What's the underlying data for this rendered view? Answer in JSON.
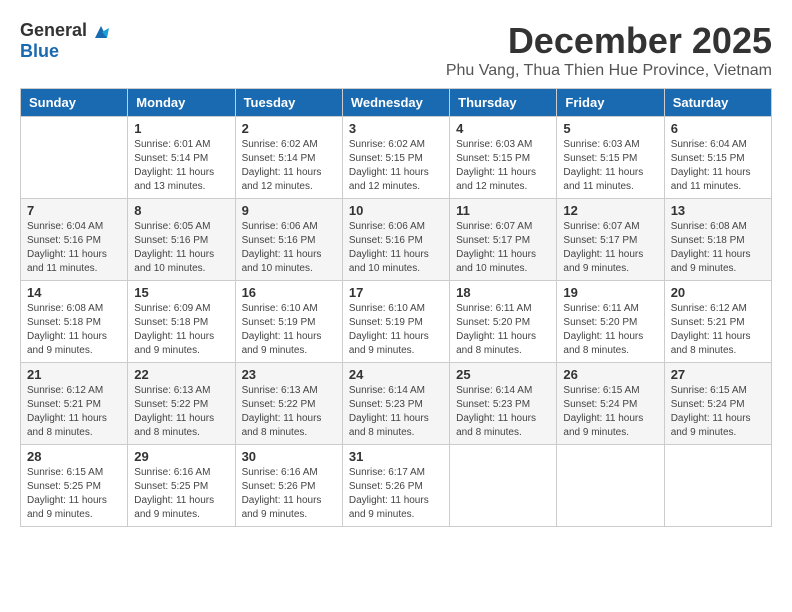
{
  "header": {
    "logo_general": "General",
    "logo_blue": "Blue",
    "month_title": "December 2025",
    "subtitle": "Phu Vang, Thua Thien Hue Province, Vietnam"
  },
  "weekdays": [
    "Sunday",
    "Monday",
    "Tuesday",
    "Wednesday",
    "Thursday",
    "Friday",
    "Saturday"
  ],
  "weeks": [
    [
      {
        "day": "",
        "sunrise": "",
        "sunset": "",
        "daylight": ""
      },
      {
        "day": "1",
        "sunrise": "Sunrise: 6:01 AM",
        "sunset": "Sunset: 5:14 PM",
        "daylight": "Daylight: 11 hours and 13 minutes."
      },
      {
        "day": "2",
        "sunrise": "Sunrise: 6:02 AM",
        "sunset": "Sunset: 5:14 PM",
        "daylight": "Daylight: 11 hours and 12 minutes."
      },
      {
        "day": "3",
        "sunrise": "Sunrise: 6:02 AM",
        "sunset": "Sunset: 5:15 PM",
        "daylight": "Daylight: 11 hours and 12 minutes."
      },
      {
        "day": "4",
        "sunrise": "Sunrise: 6:03 AM",
        "sunset": "Sunset: 5:15 PM",
        "daylight": "Daylight: 11 hours and 12 minutes."
      },
      {
        "day": "5",
        "sunrise": "Sunrise: 6:03 AM",
        "sunset": "Sunset: 5:15 PM",
        "daylight": "Daylight: 11 hours and 11 minutes."
      },
      {
        "day": "6",
        "sunrise": "Sunrise: 6:04 AM",
        "sunset": "Sunset: 5:15 PM",
        "daylight": "Daylight: 11 hours and 11 minutes."
      }
    ],
    [
      {
        "day": "7",
        "sunrise": "Sunrise: 6:04 AM",
        "sunset": "Sunset: 5:16 PM",
        "daylight": "Daylight: 11 hours and 11 minutes."
      },
      {
        "day": "8",
        "sunrise": "Sunrise: 6:05 AM",
        "sunset": "Sunset: 5:16 PM",
        "daylight": "Daylight: 11 hours and 10 minutes."
      },
      {
        "day": "9",
        "sunrise": "Sunrise: 6:06 AM",
        "sunset": "Sunset: 5:16 PM",
        "daylight": "Daylight: 11 hours and 10 minutes."
      },
      {
        "day": "10",
        "sunrise": "Sunrise: 6:06 AM",
        "sunset": "Sunset: 5:16 PM",
        "daylight": "Daylight: 11 hours and 10 minutes."
      },
      {
        "day": "11",
        "sunrise": "Sunrise: 6:07 AM",
        "sunset": "Sunset: 5:17 PM",
        "daylight": "Daylight: 11 hours and 10 minutes."
      },
      {
        "day": "12",
        "sunrise": "Sunrise: 6:07 AM",
        "sunset": "Sunset: 5:17 PM",
        "daylight": "Daylight: 11 hours and 9 minutes."
      },
      {
        "day": "13",
        "sunrise": "Sunrise: 6:08 AM",
        "sunset": "Sunset: 5:18 PM",
        "daylight": "Daylight: 11 hours and 9 minutes."
      }
    ],
    [
      {
        "day": "14",
        "sunrise": "Sunrise: 6:08 AM",
        "sunset": "Sunset: 5:18 PM",
        "daylight": "Daylight: 11 hours and 9 minutes."
      },
      {
        "day": "15",
        "sunrise": "Sunrise: 6:09 AM",
        "sunset": "Sunset: 5:18 PM",
        "daylight": "Daylight: 11 hours and 9 minutes."
      },
      {
        "day": "16",
        "sunrise": "Sunrise: 6:10 AM",
        "sunset": "Sunset: 5:19 PM",
        "daylight": "Daylight: 11 hours and 9 minutes."
      },
      {
        "day": "17",
        "sunrise": "Sunrise: 6:10 AM",
        "sunset": "Sunset: 5:19 PM",
        "daylight": "Daylight: 11 hours and 9 minutes."
      },
      {
        "day": "18",
        "sunrise": "Sunrise: 6:11 AM",
        "sunset": "Sunset: 5:20 PM",
        "daylight": "Daylight: 11 hours and 8 minutes."
      },
      {
        "day": "19",
        "sunrise": "Sunrise: 6:11 AM",
        "sunset": "Sunset: 5:20 PM",
        "daylight": "Daylight: 11 hours and 8 minutes."
      },
      {
        "day": "20",
        "sunrise": "Sunrise: 6:12 AM",
        "sunset": "Sunset: 5:21 PM",
        "daylight": "Daylight: 11 hours and 8 minutes."
      }
    ],
    [
      {
        "day": "21",
        "sunrise": "Sunrise: 6:12 AM",
        "sunset": "Sunset: 5:21 PM",
        "daylight": "Daylight: 11 hours and 8 minutes."
      },
      {
        "day": "22",
        "sunrise": "Sunrise: 6:13 AM",
        "sunset": "Sunset: 5:22 PM",
        "daylight": "Daylight: 11 hours and 8 minutes."
      },
      {
        "day": "23",
        "sunrise": "Sunrise: 6:13 AM",
        "sunset": "Sunset: 5:22 PM",
        "daylight": "Daylight: 11 hours and 8 minutes."
      },
      {
        "day": "24",
        "sunrise": "Sunrise: 6:14 AM",
        "sunset": "Sunset: 5:23 PM",
        "daylight": "Daylight: 11 hours and 8 minutes."
      },
      {
        "day": "25",
        "sunrise": "Sunrise: 6:14 AM",
        "sunset": "Sunset: 5:23 PM",
        "daylight": "Daylight: 11 hours and 8 minutes."
      },
      {
        "day": "26",
        "sunrise": "Sunrise: 6:15 AM",
        "sunset": "Sunset: 5:24 PM",
        "daylight": "Daylight: 11 hours and 9 minutes."
      },
      {
        "day": "27",
        "sunrise": "Sunrise: 6:15 AM",
        "sunset": "Sunset: 5:24 PM",
        "daylight": "Daylight: 11 hours and 9 minutes."
      }
    ],
    [
      {
        "day": "28",
        "sunrise": "Sunrise: 6:15 AM",
        "sunset": "Sunset: 5:25 PM",
        "daylight": "Daylight: 11 hours and 9 minutes."
      },
      {
        "day": "29",
        "sunrise": "Sunrise: 6:16 AM",
        "sunset": "Sunset: 5:25 PM",
        "daylight": "Daylight: 11 hours and 9 minutes."
      },
      {
        "day": "30",
        "sunrise": "Sunrise: 6:16 AM",
        "sunset": "Sunset: 5:26 PM",
        "daylight": "Daylight: 11 hours and 9 minutes."
      },
      {
        "day": "31",
        "sunrise": "Sunrise: 6:17 AM",
        "sunset": "Sunset: 5:26 PM",
        "daylight": "Daylight: 11 hours and 9 minutes."
      },
      {
        "day": "",
        "sunrise": "",
        "sunset": "",
        "daylight": ""
      },
      {
        "day": "",
        "sunrise": "",
        "sunset": "",
        "daylight": ""
      },
      {
        "day": "",
        "sunrise": "",
        "sunset": "",
        "daylight": ""
      }
    ]
  ]
}
